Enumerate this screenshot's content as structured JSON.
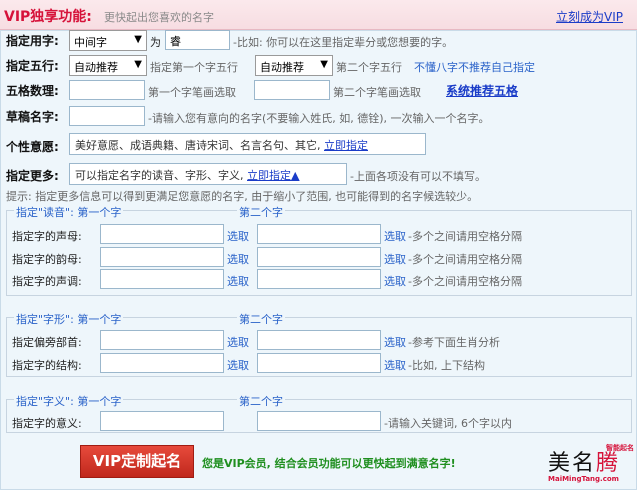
{
  "header": {
    "title": "VIP独享功能:",
    "subtitle": "更快起出您喜欢的名字",
    "vip_link": "立刻成为VIP"
  },
  "row_specify_char": {
    "label": "指定用字:",
    "position_select": "中间字",
    "as_text": "为",
    "char_value": "睿",
    "hint": "-比如: 你可以在这里指定辈分或您想要的字。"
  },
  "row_five_elements": {
    "label": "指定五行:",
    "select1": "自动推荐",
    "text1": "指定第一个字五行",
    "select2": "自动推荐",
    "text2": "第二个字五行",
    "tip": "不懂八字不推荐自己指定"
  },
  "row_five_grid": {
    "label": "五格数理:",
    "text1": "第一个字笔画选取",
    "text2": "第二个字笔画选取",
    "link": "系统推荐五格"
  },
  "row_draft": {
    "label": "草稿名字:",
    "hint": "-请输入您有意向的名字(不要输入姓氏, 如, 德铨), 一次输入一个名字。"
  },
  "row_meaning": {
    "label": "个性意愿:",
    "options": "美好意愿、成语典籍、唐诗宋词、名言名句、其它,",
    "link": "立即指定"
  },
  "row_more": {
    "label": "指定更多:",
    "text": "可以指定名字的读音、字形、字义,",
    "link": "立即指定▲",
    "hint": "-上面各项没有可以不填写。"
  },
  "notice": "提示: 指定更多信息可以得到更满足您意愿的名字, 由于缩小了范围, 也可能得到的名字候选较少。",
  "group_sound": {
    "legend": "指定\"读音\": 第一个字",
    "second": "第二个字",
    "rows": [
      {
        "label": "指定字的声母:",
        "pick1": "选取",
        "pick2": "选取",
        "note": "-多个之间请用空格分隔"
      },
      {
        "label": "指定字的韵母:",
        "pick1": "选取",
        "pick2": "选取",
        "note": "-多个之间请用空格分隔"
      },
      {
        "label": "指定字的声调:",
        "pick1": "选取",
        "pick2": "选取",
        "note": "-多个之间请用空格分隔"
      }
    ]
  },
  "group_shape": {
    "legend": "指定\"字形\": 第一个字",
    "second": "第二个字",
    "rows": [
      {
        "label": "指定偏旁部首:",
        "pick1": "选取",
        "pick2": "选取",
        "note": "-参考下面生肖分析"
      },
      {
        "label": "指定字的结构:",
        "pick1": "选取",
        "pick2": "选取",
        "note": "-比如, 上下结构"
      }
    ]
  },
  "group_meaning": {
    "legend": "指定\"字义\": 第一个字",
    "second": "第二个字",
    "rows": [
      {
        "label": "指定字的意义:",
        "note": "-请输入关键词, 6个字以内"
      }
    ]
  },
  "vip_button": "VIP定制起名",
  "member_note": "您是VIP会员, 结合会员功能可以更快起到满意名字!",
  "logo": {
    "text_main": "美名",
    "text_accent": "腾",
    "tagline": "智能起名",
    "url": "MaiMingTang.com"
  }
}
